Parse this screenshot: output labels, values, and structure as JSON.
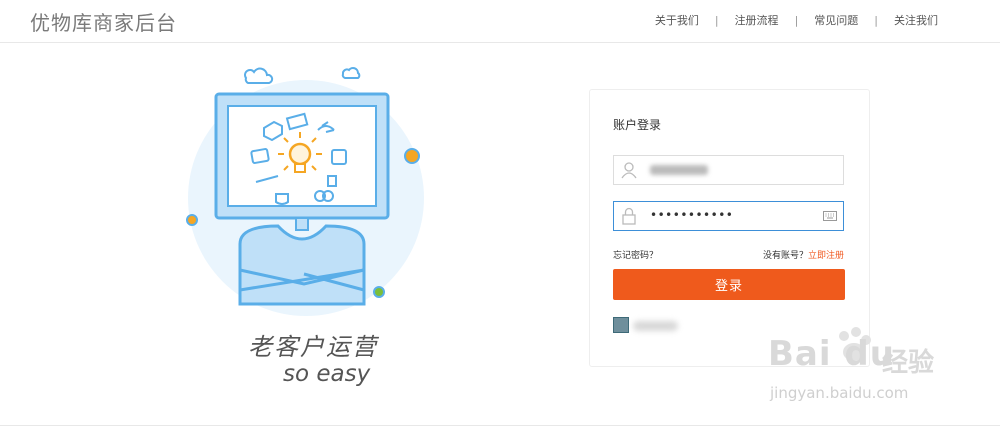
{
  "header": {
    "title": "优物库商家后台",
    "nav": [
      "关于我们",
      "注册流程",
      "常见问题",
      "关注我们"
    ],
    "separator": "|"
  },
  "slogan": {
    "line1": "老客户运营",
    "line2": "so easy"
  },
  "login": {
    "title": "账户登录",
    "password_mask": "•••••••••••",
    "forgot": "忘记密码？",
    "no_account": "没有账号？",
    "register": "立即注册",
    "submit": "登录"
  },
  "colors": {
    "accent": "#ef5a1c",
    "illustration_blue": "#5aaee8",
    "input_focus": "#3d8fd8"
  },
  "icons": [
    "user-icon",
    "lock-icon",
    "keyboard-icon",
    "cloud-icon",
    "lightbulb-icon",
    "monitor-icon"
  ],
  "watermark": {
    "brand": "Bai du",
    "product": "经验",
    "url": "jingyan.baidu.com"
  }
}
